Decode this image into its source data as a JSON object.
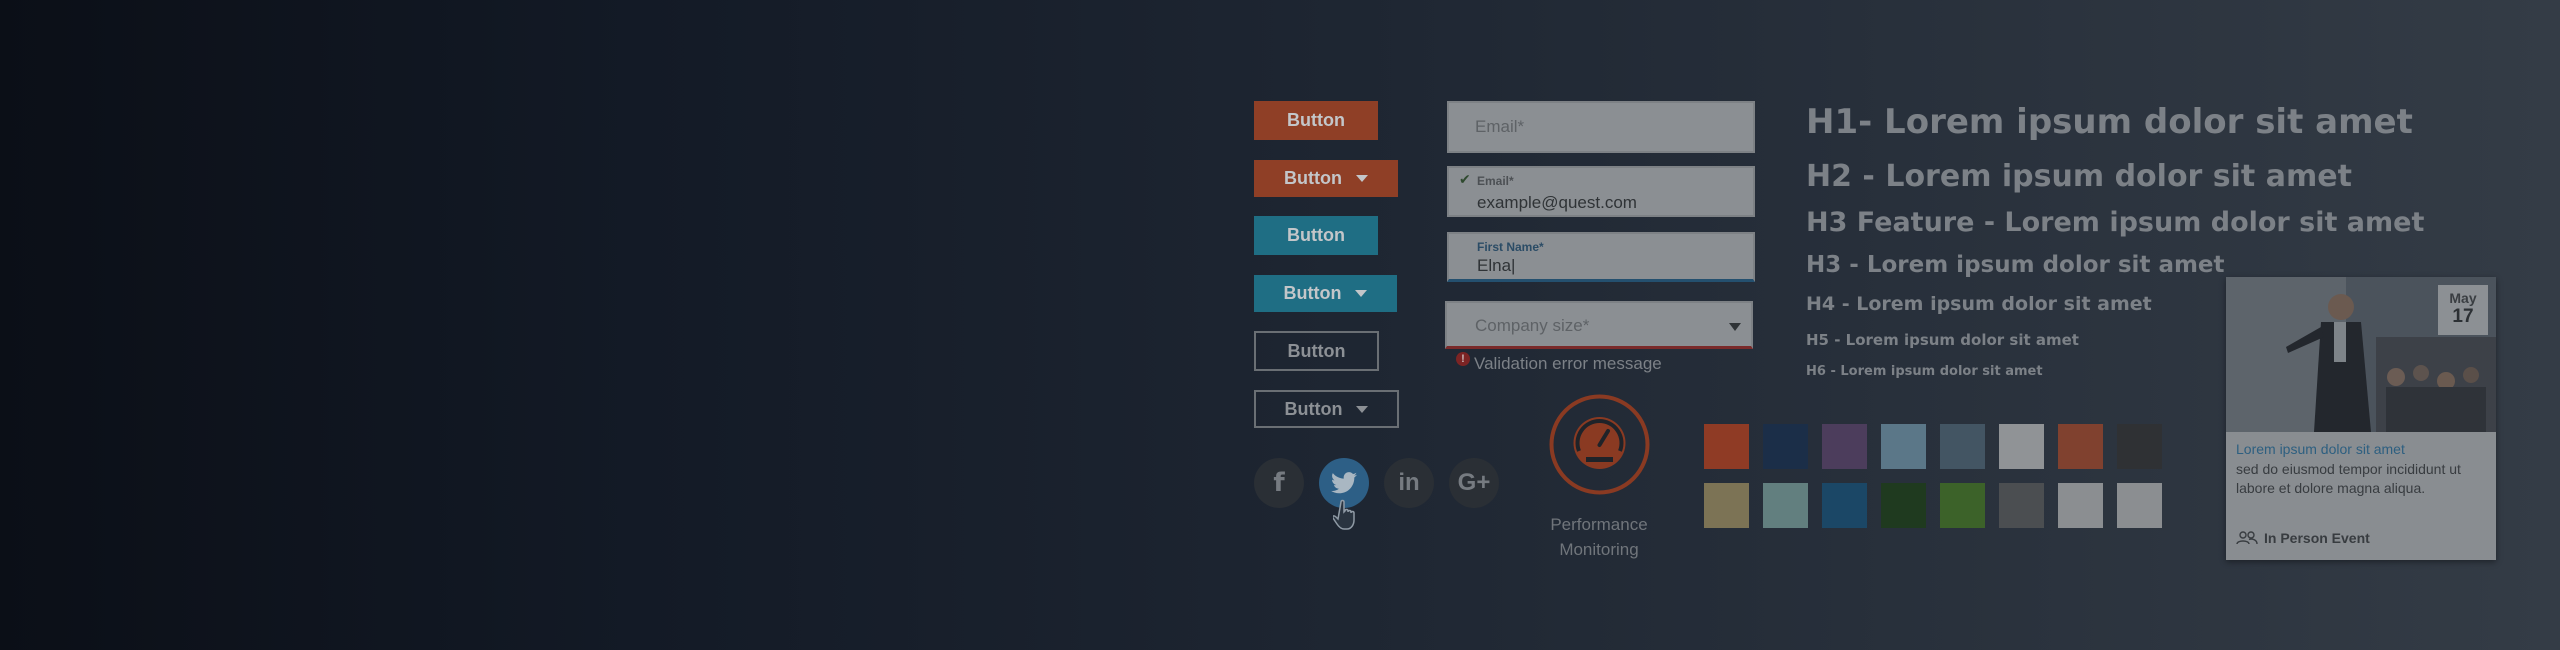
{
  "buttons": {
    "primary_label": "Button",
    "primary_dropdown_label": "Button",
    "secondary_label": "Button",
    "secondary_dropdown_label": "Button",
    "outline_label": "Button",
    "outline_dropdown_label": "Button"
  },
  "form": {
    "email_placeholder": "Email*",
    "email_valid_label": "Email*",
    "email_valid_value": "example@quest.com",
    "firstname_label": "First Name*",
    "firstname_value": "Elna|",
    "company_placeholder": "Company size*",
    "error_message": "Validation error message",
    "error_icon_glyph": "!"
  },
  "headings": {
    "h1": "H1- Lorem ipsum dolor sit amet",
    "h2": "H2 - Lorem ipsum dolor sit amet",
    "h3_feature": "H3 Feature - Lorem ipsum dolor sit amet",
    "h3": "H3 - Lorem ipsum dolor sit amet",
    "h4": "H4 - Lorem ipsum dolor sit amet",
    "h5": "H5 - Lorem ipsum dolor sit amet",
    "h6": "H6 - Lorem ipsum dolor sit amet"
  },
  "social": {
    "facebook": "f",
    "linkedin": "in",
    "googleplus": "G+"
  },
  "feature": {
    "label_line1": "Performance",
    "label_line2": "Monitoring"
  },
  "swatches": {
    "row1": [
      "#8f3b25",
      "#1b2e48",
      "#4c3d5c",
      "#5b7788",
      "#435563",
      "#909396",
      "#80412f",
      "#2f3134"
    ],
    "row2": [
      "#7c7355",
      "#627f7f",
      "#1b4766",
      "#1f3a1f",
      "#3c6229",
      "#4b4e51",
      "#8b8e91",
      "#8b8e91"
    ]
  },
  "card": {
    "month": "May",
    "day": "17",
    "title": "Lorem ipsum dolor sit amet",
    "body": "sed do eiusmod tempor incididunt ut labore et dolore magna aliqua.",
    "event_type": "In Person Event"
  },
  "colors": {
    "accent_orange": "#8f3f26",
    "accent_teal": "#1f6e84",
    "error_red": "#8a2a2a",
    "link_blue": "#2d5f80"
  }
}
